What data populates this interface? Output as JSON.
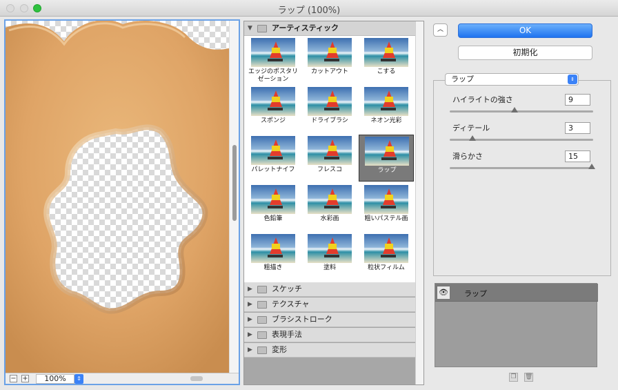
{
  "window": {
    "title": "ラップ (100%)"
  },
  "preview": {
    "zoom": "100%",
    "zoom_minus": "−",
    "zoom_plus": "+"
  },
  "browser": {
    "open_category": "アーティスティック",
    "filters": [
      {
        "label": "エッジのポスタリゼーション"
      },
      {
        "label": "カットアウト"
      },
      {
        "label": "こする"
      },
      {
        "label": "スポンジ"
      },
      {
        "label": "ドライブラシ"
      },
      {
        "label": "ネオン光彩"
      },
      {
        "label": "パレットナイフ"
      },
      {
        "label": "フレスコ"
      },
      {
        "label": "ラップ",
        "selected": true
      },
      {
        "label": "色鉛筆"
      },
      {
        "label": "水彩画"
      },
      {
        "label": "粗いパステル画"
      },
      {
        "label": "粗描き"
      },
      {
        "label": "塗料"
      },
      {
        "label": "粒状フィルム"
      }
    ],
    "categories": [
      "スケッチ",
      "テクスチャ",
      "ブラシストローク",
      "表現手法",
      "変形"
    ]
  },
  "controls": {
    "ok_label": "OK",
    "reset_label": "初期化",
    "filter_select": "ラップ",
    "sliders": [
      {
        "label": "ハイライトの強さ",
        "value": "9",
        "fraction": 0.45
      },
      {
        "label": "ディテール",
        "value": "3",
        "fraction": 0.15
      },
      {
        "label": "滑らかさ",
        "value": "15",
        "fraction": 1.0
      }
    ]
  },
  "layers": {
    "items": [
      {
        "name": "ラップ"
      }
    ]
  },
  "colors": {
    "accent": "#1f73f0",
    "preview_border": "#6aa1e6",
    "plastic": "#e2a864"
  }
}
